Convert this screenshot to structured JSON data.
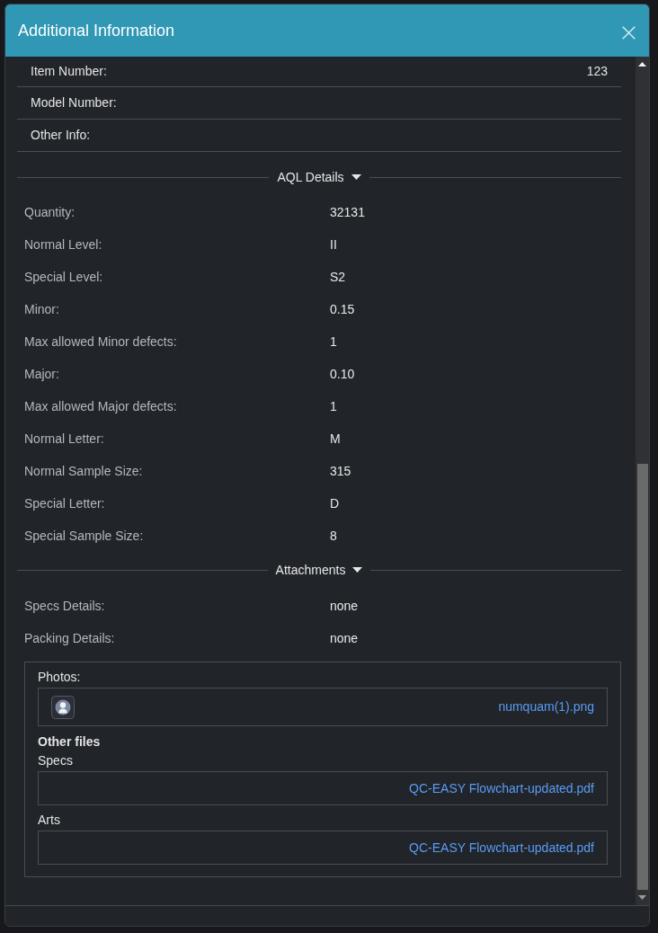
{
  "dialog": {
    "title": "Additional Information"
  },
  "info_rows": [
    {
      "label": "Item Number:",
      "value": "123"
    },
    {
      "label": "Model Number:"
    },
    {
      "label": "Other Info:"
    }
  ],
  "sections": [
    {
      "title": "AQL Details",
      "expanded": true,
      "rows": [
        {
          "label": "Quantity:",
          "value": "32131"
        },
        {
          "label": "Normal Level:",
          "value": "II"
        },
        {
          "label": "Special Level:",
          "value": "S2"
        },
        {
          "label": "Minor:",
          "value": "0.15"
        },
        {
          "label": "Max allowed Minor defects:",
          "value": "1"
        },
        {
          "label": "Major:",
          "value": "0.10"
        },
        {
          "label": "Max allowed Major defects:",
          "value": "1"
        },
        {
          "label": "Normal Letter:",
          "value": "M"
        },
        {
          "label": "Normal Sample Size:",
          "value": "315"
        },
        {
          "label": "Special Letter:",
          "value": "D"
        },
        {
          "label": "Special Sample Size:",
          "value": "8"
        }
      ]
    },
    {
      "title": "Attachments",
      "expanded": true,
      "rows": [
        {
          "label": "Specs Details:",
          "value": "none"
        },
        {
          "label": "Packing Details:",
          "value": "none"
        }
      ]
    }
  ],
  "attachments": {
    "photos": {
      "label": "Photos:",
      "files": [
        {
          "name": "numquam(1).png"
        }
      ]
    },
    "other_files": {
      "title": "Other files",
      "groups": [
        {
          "label": "Specs",
          "files": [
            {
              "name": "QC-EASY Flowchart-updated.pdf"
            }
          ]
        },
        {
          "label": "Arts",
          "files": [
            {
              "name": "QC-EASY Flowchart-updated.pdf"
            }
          ]
        }
      ]
    }
  }
}
